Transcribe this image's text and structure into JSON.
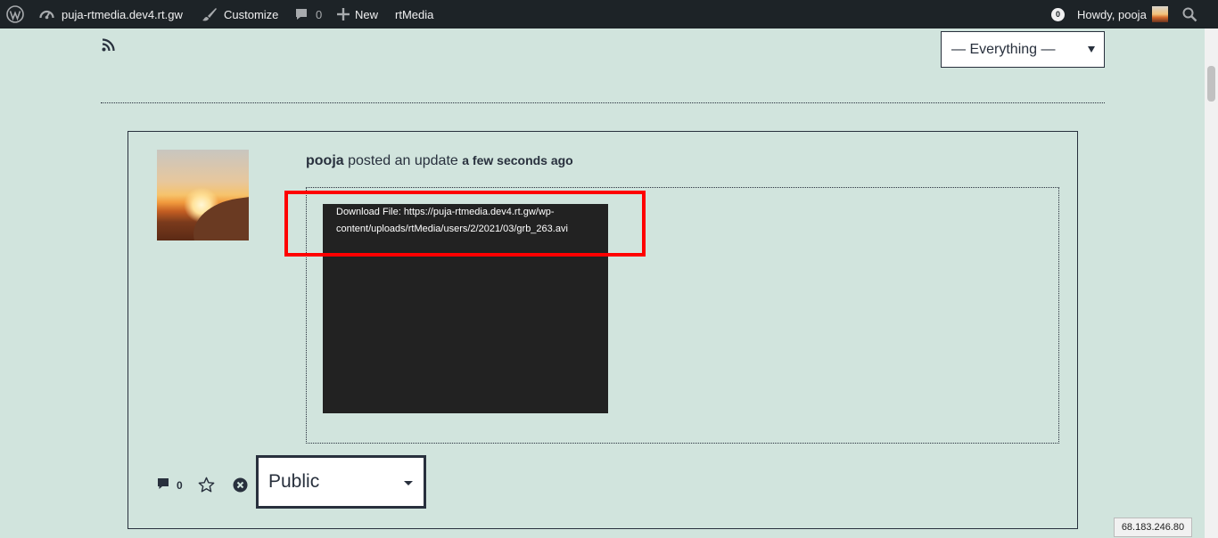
{
  "adminbar": {
    "site_name": "puja-rtmedia.dev4.rt.gw",
    "customize_label": "Customize",
    "comments_count": "0",
    "new_label": "New",
    "rtmedia_label": "rtMedia",
    "notifications_count": "0",
    "howdy_text": "Howdy, pooja"
  },
  "filter": {
    "selected": "— Everything —"
  },
  "activity": {
    "author": "pooja",
    "action_text": "posted an update",
    "time_text": "a few seconds ago",
    "download_text": "Download File: https://puja-rtmedia.dev4.rt.gw/wp-content/uploads/rtMedia/users/2/2021/03/grb_263.avi",
    "comment_count": "0",
    "privacy_selected": "Public"
  },
  "ip_address": "68.183.246.80"
}
